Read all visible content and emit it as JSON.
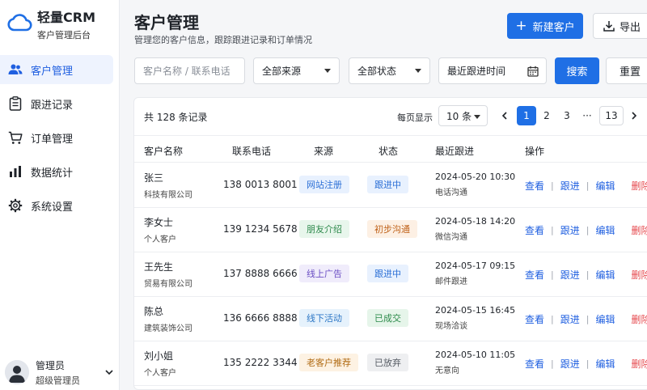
{
  "brand": {
    "name": "轻量CRM",
    "subtitle": "客户管理后台"
  },
  "nav": [
    {
      "label": "客户管理",
      "icon": "users-icon",
      "active": true
    },
    {
      "label": "跟进记录",
      "icon": "clipboard-icon",
      "active": false
    },
    {
      "label": "订单管理",
      "icon": "cart-icon",
      "active": false
    },
    {
      "label": "数据统计",
      "icon": "bar-chart-icon",
      "active": false
    },
    {
      "label": "系统设置",
      "icon": "gear-icon",
      "active": false
    }
  ],
  "user": {
    "name": "管理员",
    "role": "超级管理员"
  },
  "page": {
    "title": "客户管理",
    "subtitle": "管理您的客户信息，跟踪跟进记录和订单情况"
  },
  "actions": {
    "new_label": "新建客户",
    "export_label": "导出"
  },
  "filters": {
    "search_placeholder": "客户名称 / 联系电话",
    "source": "全部来源",
    "status": "全部状态",
    "date_placeholder": "最近跟进时间",
    "search_label": "搜索",
    "reset_label": "重置"
  },
  "table": {
    "total": "共 128 条记录",
    "per_page_label": "每页显示",
    "per_page": "10 条",
    "pages": [
      "1",
      "2",
      "3",
      "···",
      "13"
    ],
    "current_page": "1",
    "headers": [
      "客户名称",
      "联系电话",
      "来源",
      "状态",
      "最近跟进",
      "操作"
    ],
    "op_labels": {
      "view": "查看",
      "follow": "跟进",
      "edit": "编辑",
      "delete": "删除"
    },
    "rows": [
      {
        "name": "张三",
        "company": "科技有限公司",
        "phone": "138 0013 8001",
        "source": "网站注册",
        "status": "跟进中",
        "time": "2024-05-20 10:30",
        "method": "电话沟通"
      },
      {
        "name": "李女士",
        "company": "个人客户",
        "phone": "139 1234 5678",
        "source": "朋友介绍",
        "status": "初步沟通",
        "time": "2024-05-18 14:20",
        "method": "微信沟通"
      },
      {
        "name": "王先生",
        "company": "贸易有限公司",
        "phone": "137 8888 6666",
        "source": "线上广告",
        "status": "跟进中",
        "time": "2024-05-17 09:15",
        "method": "邮件跟进"
      },
      {
        "name": "陈总",
        "company": "建筑装饰公司",
        "phone": "136 6666 8888",
        "source": "线下活动",
        "status": "已成交",
        "time": "2024-05-15 16:45",
        "method": "现场洽谈"
      },
      {
        "name": "刘小姐",
        "company": "个人客户",
        "phone": "135 2222 3344",
        "source": "老客户推荐",
        "status": "已放弃",
        "time": "2024-05-10 11:05",
        "method": "无意向"
      }
    ]
  },
  "colors": {
    "primary": "#1f6fe5",
    "source_tags": {
      "网站注册": [
        "#e8f1fe",
        "#2b6fd6"
      ],
      "朋友介绍": [
        "#e8f6ec",
        "#2f8a4d"
      ],
      "线上广告": [
        "#f0ecfb",
        "#6b4fc4"
      ],
      "线下活动": [
        "#e6f2fc",
        "#2d77c6"
      ],
      "老客户推荐": [
        "#fdf2e3",
        "#b06a12"
      ]
    },
    "status_tags": {
      "跟进中": [
        "#e8f1fe",
        "#2b6fd6"
      ],
      "初步沟通": [
        "#fdf0e4",
        "#c0621a"
      ],
      "已成交": [
        "#e6f5ea",
        "#2c8a4a"
      ],
      "已放弃": [
        "#eeeff1",
        "#555b63"
      ]
    }
  }
}
